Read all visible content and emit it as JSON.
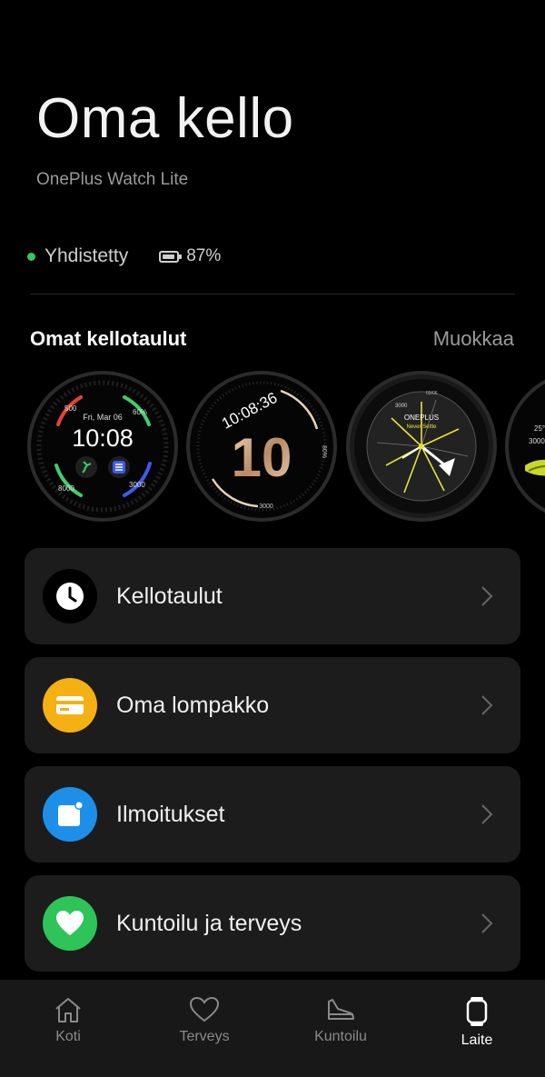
{
  "header": {
    "title": "Oma kello",
    "subtitle": "OnePlus Watch Lite"
  },
  "status": {
    "connection": "Yhdistetty",
    "battery": "87%",
    "connection_color": "#34c759"
  },
  "watchfaces": {
    "section_title": "Omat kellotaulut",
    "edit_label": "Muokkaa",
    "face1": {
      "date": "Fri, Mar 06",
      "time": "10:08",
      "tl": "500",
      "tr": "60%",
      "bl": "8000",
      "br": "3000"
    },
    "face2": {
      "time": "10:08:36",
      "big": "10",
      "pct": "80%",
      "steps": "3000"
    },
    "face3": {
      "brand": "ONEPLUS",
      "tagline": "Never Settle",
      "steps": "3000",
      "date": "03/06"
    },
    "face4": {
      "temp": "25°",
      "steps": "3000"
    }
  },
  "menu": [
    {
      "label": "Kellotaulut",
      "icon": "clock-icon",
      "color": "#000000"
    },
    {
      "label": "Oma lompakko",
      "icon": "wallet-card-icon",
      "color": "#f5b014"
    },
    {
      "label": "Ilmoitukset",
      "icon": "notification-icon",
      "color": "#1e8fe8"
    },
    {
      "label": "Kuntoilu ja terveys",
      "icon": "heart-icon",
      "color": "#2ec457"
    }
  ],
  "nav": {
    "home": "Koti",
    "health": "Terveys",
    "fitness": "Kuntoilu",
    "device": "Laite",
    "active": "Laite"
  }
}
